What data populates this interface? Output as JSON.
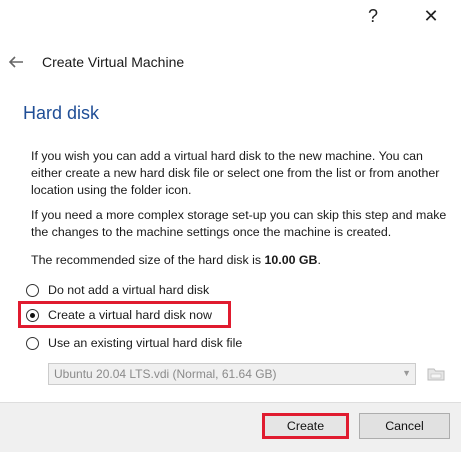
{
  "titlebar": {
    "help_icon": "help-icon",
    "help_label": "?",
    "close_icon": "close-icon",
    "close_label": "✕"
  },
  "header": {
    "back_icon": "back-arrow-icon",
    "title": "Create Virtual Machine"
  },
  "section": {
    "title": "Hard disk"
  },
  "description": {
    "para1": "If you wish you can add a virtual hard disk to the new machine. You can either create a new hard disk file or select one from the list or from another location using the folder icon.",
    "para2": "If you need a more complex storage set-up you can skip this step and make the changes to the machine settings once the machine is created.",
    "para3_prefix": "The recommended size of the hard disk is ",
    "para3_size": "10.00 GB",
    "para3_suffix": "."
  },
  "options": [
    {
      "label": "Do not add a virtual hard disk",
      "checked": false
    },
    {
      "label": "Create a virtual hard disk now",
      "checked": true,
      "highlighted": true
    },
    {
      "label": "Use an existing virtual hard disk file",
      "checked": false
    }
  ],
  "disk_select": {
    "value": "Ubuntu 20.04 LTS.vdi (Normal, 61.64 GB)",
    "enabled": false,
    "folder_icon": "folder-icon"
  },
  "footer": {
    "create_label": "Create",
    "cancel_label": "Cancel"
  },
  "colors": {
    "accent_title": "#1f4e96",
    "highlight": "#e01b2f",
    "footer_bg": "#f0f0f0"
  }
}
